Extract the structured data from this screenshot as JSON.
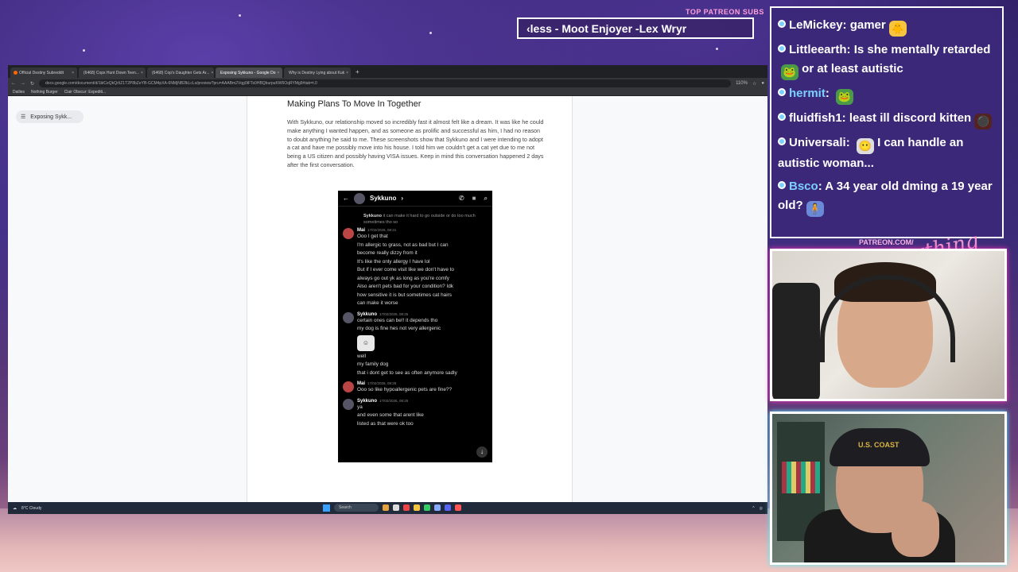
{
  "overlay": {
    "patreon_subs_label": "TOP PATREON SUBS",
    "ticker_text": "‹less - Moot Enjoyer -Lex Wryr",
    "patreon_url": "PATREON.COM/",
    "signature": "Anything Else"
  },
  "browser": {
    "tabs": [
      {
        "label": "Official Destiny Subreddit",
        "active": false
      },
      {
        "label": "(6468) Cops Hunt Down Teen...",
        "active": false
      },
      {
        "label": "(6468) Cop's Daughter Gets Ar...",
        "active": false
      },
      {
        "label": "Exposing Sykkuno - Google Do",
        "active": true
      },
      {
        "label": "Why is Destiny Lying about Kuk",
        "active": false
      }
    ],
    "new_tab": "+",
    "url": "docs.google.com/document/d/1blCeQkQrIiZ1T2P8bZeYB-GCM4pXA-6NMjNB2lkLcLs/preview?pru=AAABm2Vqg0tFTs0HBQburpuKW6OqRYMg9#tab=t.0",
    "zoom": "110%",
    "bookmarks": [
      "Dailies",
      "Nothing Burger",
      "Clair Obscur: Expediti..."
    ]
  },
  "doc": {
    "outline_item": "Exposing Sykk...",
    "heading": "Making Plans To Move In Together",
    "paragraph": "With Sykkuno, our relationship moved so incredibly fast it almost felt like a dream. It was like he could make anything I wanted happen, and as someone as prolific and successful as him, I had no reason to doubt anything he said to me. These screenshots show that Sykkuno and I were intending to adopt a cat and have me possibly move into his house. I told him we couldn't get a cat yet due to me not being a US citizen and possibly having VISA issues. Keep in mind this conversation happened 2 days after the first conversation."
  },
  "discord": {
    "header_name": "Sykkuno",
    "badge": "99",
    "reply_name": "Sykkuno",
    "reply_text": "it can make it hard to go outside or do too much sometimes tho so",
    "messages": [
      {
        "author": "Mai",
        "time": "17/02/2026, 08:21",
        "lines": [
          "Ooo I get that",
          "I'm allergic to grass, not as bad but I can",
          "become really dizzy from it",
          "It's like the only allergy I have lol",
          "But if I ever come visit like we don't have to",
          "always go out yk as long as you're comfy",
          "Also aren't pets bad for your condition? Idk",
          "how sensitive it is but sometimes cat hairs",
          "can make it worse"
        ],
        "sticker": false
      },
      {
        "author": "Sykkuno",
        "time": "17/02/2026, 08:25",
        "lines": [
          "certain ones can be!! it depends tho",
          "my dog is fine hes not very allergenic"
        ],
        "sticker": true,
        "after_sticker": [
          "well",
          "my family dog",
          "that i dont get to see as often anymore sadly"
        ]
      },
      {
        "author": "Mai",
        "time": "17/02/2026, 08:25",
        "lines": [
          "Ooo so like hypoallergenic pets are fine??"
        ],
        "sticker": false
      },
      {
        "author": "Sykkuno",
        "time": "17/02/2026, 08:25",
        "lines": [
          "ya",
          "and even some that arent like",
          "listed as that were ok too"
        ],
        "sticker": false
      }
    ]
  },
  "taskbar": {
    "weather_temp": "8°C",
    "weather_desc": "Cloudy",
    "search_placeholder": "Search"
  },
  "chat": {
    "messages": [
      {
        "user": "LeMickey",
        "text": "gamer",
        "emote": "🐥",
        "blue": false
      },
      {
        "user": "Littleearth",
        "text": "Is she mentally retarded",
        "text2": "or at least autistic",
        "emote": "🐸",
        "blue": false
      },
      {
        "user": "hermit",
        "text": "",
        "emote": "🐸",
        "blue": true
      },
      {
        "user": "fluidfish1",
        "text": "least ill discord kitten",
        "emote": "⚫",
        "blue": false
      },
      {
        "user": "Universali",
        "text": "I can handle an autistic woman...",
        "emote": "😶",
        "blue": false
      },
      {
        "user": "Bsco",
        "text": "A 34 year old dming a 19 year old?",
        "emote": "🧍",
        "blue": true
      }
    ]
  },
  "webcams": {
    "cam2_cap_text": "U.S. COAST"
  },
  "colors": {
    "accent_pink": "#ff9fd8",
    "chat_bg": "#3c2878",
    "link_blue": "#7ad0ff"
  }
}
